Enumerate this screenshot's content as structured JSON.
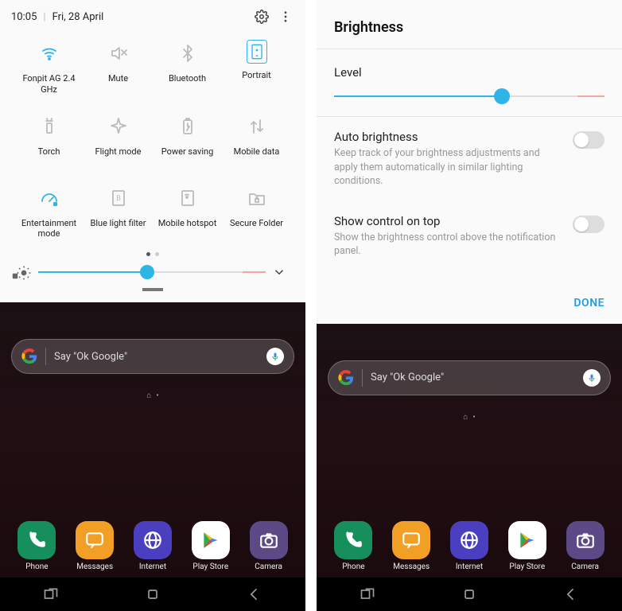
{
  "left": {
    "status": {
      "time": "10:05",
      "date": "Fri, 28 April"
    },
    "tiles": [
      {
        "label": "Fonpit AG 2.4 GHz",
        "icon": "wifi",
        "active": true
      },
      {
        "label": "Mute",
        "icon": "mute",
        "active": false
      },
      {
        "label": "Bluetooth",
        "icon": "bluetooth",
        "active": false
      },
      {
        "label": "Portrait",
        "icon": "portrait",
        "active": true,
        "boxed": true
      },
      {
        "label": "Torch",
        "icon": "torch",
        "active": false
      },
      {
        "label": "Flight mode",
        "icon": "airplane",
        "active": false
      },
      {
        "label": "Power saving",
        "icon": "battery",
        "active": false
      },
      {
        "label": "Mobile data",
        "icon": "mobiledata",
        "active": false
      },
      {
        "label": "Entertainment mode",
        "icon": "gauge",
        "active": true
      },
      {
        "label": "Blue light filter",
        "icon": "bluefilter",
        "active": false
      },
      {
        "label": "Mobile hotspot",
        "icon": "hotspot",
        "active": false
      },
      {
        "label": "Secure Folder",
        "icon": "securefolder",
        "active": false
      }
    ],
    "pager": {
      "current": 0,
      "total": 2
    },
    "brightness": {
      "value_pct": 48,
      "warn_pct": 10
    }
  },
  "right": {
    "title": "Brightness",
    "level_label": "Level",
    "level": {
      "value_pct": 62,
      "warn_pct": 10
    },
    "auto": {
      "title": "Auto brightness",
      "sub": "Keep track of your brightness adjustments and apply them automatically in similar lighting conditions.",
      "on": false
    },
    "show_top": {
      "title": "Show control on top",
      "sub": "Show the brightness control above the notification panel.",
      "on": false
    },
    "done": "DONE"
  },
  "home": {
    "search_placeholder": "Say \"Ok Google\"",
    "apps": [
      {
        "label": "Phone",
        "color": "#178f5d",
        "glyph": "phone"
      },
      {
        "label": "Messages",
        "color": "#f29f26",
        "glyph": "msg"
      },
      {
        "label": "Internet",
        "color": "#4a3fbf",
        "glyph": "globe"
      },
      {
        "label": "Play Store",
        "color": "#ffffff",
        "glyph": "play"
      },
      {
        "label": "Camera",
        "color": "#5b4a86",
        "glyph": "camera"
      }
    ]
  }
}
